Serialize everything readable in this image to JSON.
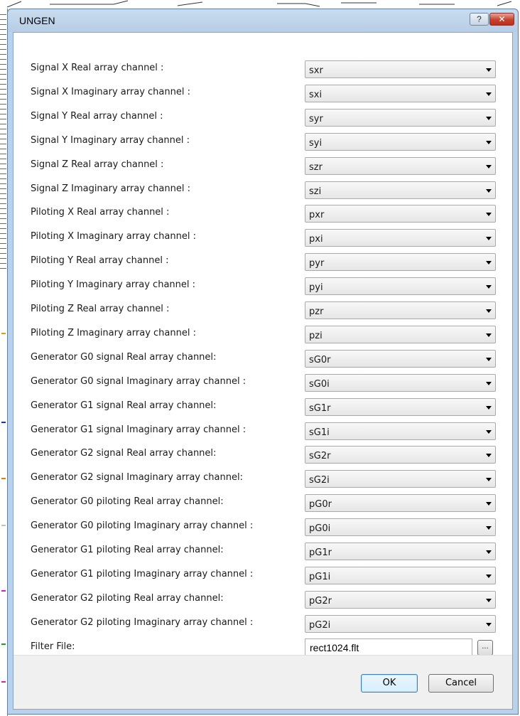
{
  "window": {
    "title": "UNGEN",
    "help_glyph": "?",
    "close_glyph": "✕"
  },
  "fields": [
    {
      "label": "Signal X Real array channel :",
      "value": "sxr"
    },
    {
      "label": "Signal X Imaginary array channel :",
      "value": "sxi"
    },
    {
      "label": "Signal Y Real array channel :",
      "value": "syr"
    },
    {
      "label": "Signal Y Imaginary array channel :",
      "value": "syi"
    },
    {
      "label": "Signal Z Real array channel :",
      "value": "szr"
    },
    {
      "label": "Signal Z Imaginary array channel :",
      "value": "szi"
    },
    {
      "label": "Piloting X Real array channel :",
      "value": "pxr"
    },
    {
      "label": "Piloting X Imaginary array channel :",
      "value": "pxi"
    },
    {
      "label": "Piloting Y Real array channel :",
      "value": "pyr"
    },
    {
      "label": "Piloting Y Imaginary array channel :",
      "value": "pyi"
    },
    {
      "label": "Piloting Z Real array channel :",
      "value": "pzr"
    },
    {
      "label": "Piloting Z Imaginary array channel :",
      "value": "pzi"
    },
    {
      "label": "Generator G0 signal Real array channel:",
      "value": "sG0r"
    },
    {
      "label": "Generator G0 signal Imaginary array channel :",
      "value": "sG0i"
    },
    {
      "label": "Generator G1 signal Real array channel:",
      "value": "sG1r"
    },
    {
      "label": "Generator G1 signal Imaginary array channel :",
      "value": "sG1i"
    },
    {
      "label": "Generator G2 signal Real array channel:",
      "value": "sG2r"
    },
    {
      "label": "Generator G2 signal Imaginary array channel:",
      "value": "sG2i"
    },
    {
      "label": "Generator G0 piloting Real array channel:",
      "value": "pG0r"
    },
    {
      "label": "Generator G0 piloting Imaginary array channel :",
      "value": "pG0i"
    },
    {
      "label": "Generator G1 piloting Real array channel:",
      "value": "pG1r"
    },
    {
      "label": "Generator G1 piloting Imaginary array channel :",
      "value": "pG1i"
    },
    {
      "label": "Generator G2 piloting Real array channel:",
      "value": "pG2r"
    },
    {
      "label": "Generator G2 piloting Imaginary array channel :",
      "value": "pG2i"
    }
  ],
  "filter": {
    "label": "Filter File:",
    "value": "rect1024.flt",
    "browse_label": "..."
  },
  "buttons": {
    "ok": "OK",
    "cancel": "Cancel"
  }
}
